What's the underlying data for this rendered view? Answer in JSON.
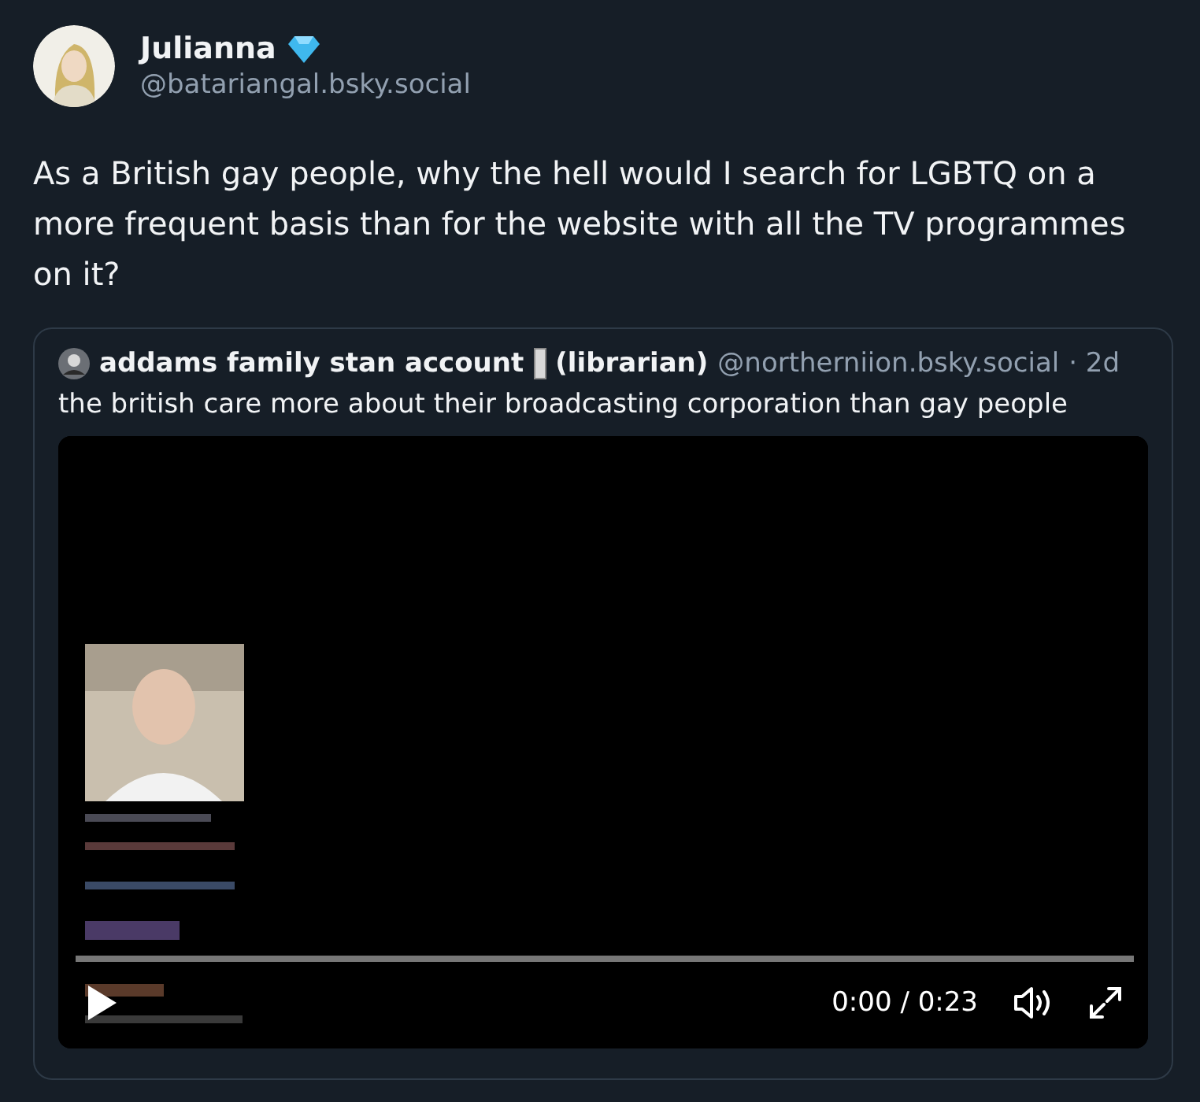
{
  "author": {
    "display_name": "Julianna",
    "handle": "@batariangal.bsky.social"
  },
  "post": {
    "text": "As a British gay people, why the hell would I search for LGBTQ on a more frequent basis than for the website with all the TV programmes on it?"
  },
  "quote": {
    "author_name": "addams family stan account",
    "author_suffix": "(librarian)",
    "handle": "@northerniion.bsky.social",
    "age": "· 2d",
    "text": "the british care more about their broadcasting corporation than gay people",
    "video": {
      "kind": "picture",
      "time": "0:00 / 0:23"
    }
  }
}
